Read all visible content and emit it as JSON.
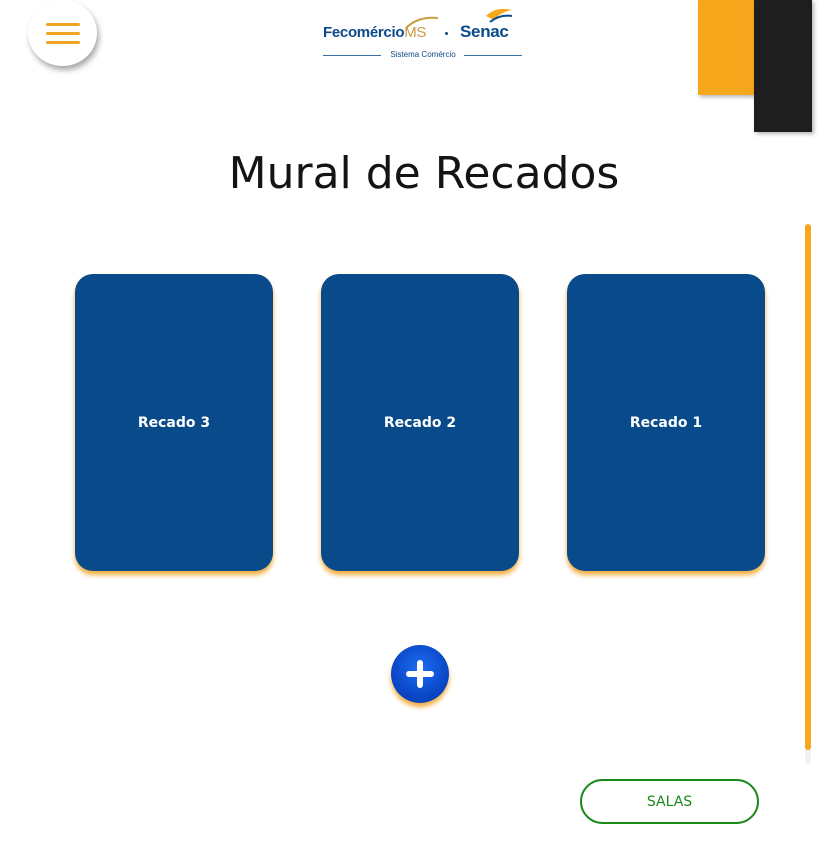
{
  "header": {
    "logo": {
      "fecomercio": "Fecomércio",
      "ms": "MS",
      "separator": "·",
      "senac": "Senac",
      "tagline": "Sistema Comércio"
    },
    "menu_icon": "hamburger-icon"
  },
  "main": {
    "title": "Mural de Recados",
    "cards": [
      {
        "label": "Recado 3"
      },
      {
        "label": "Recado 2"
      },
      {
        "label": "Recado 1"
      }
    ],
    "add_icon": "plus-icon"
  },
  "footer": {
    "salas_label": "SALAS"
  },
  "colors": {
    "accent_orange": "#f7a71c",
    "card_blue": "#094a8b",
    "dark": "#1e1e1e",
    "salas_green": "#1b8a1b"
  }
}
